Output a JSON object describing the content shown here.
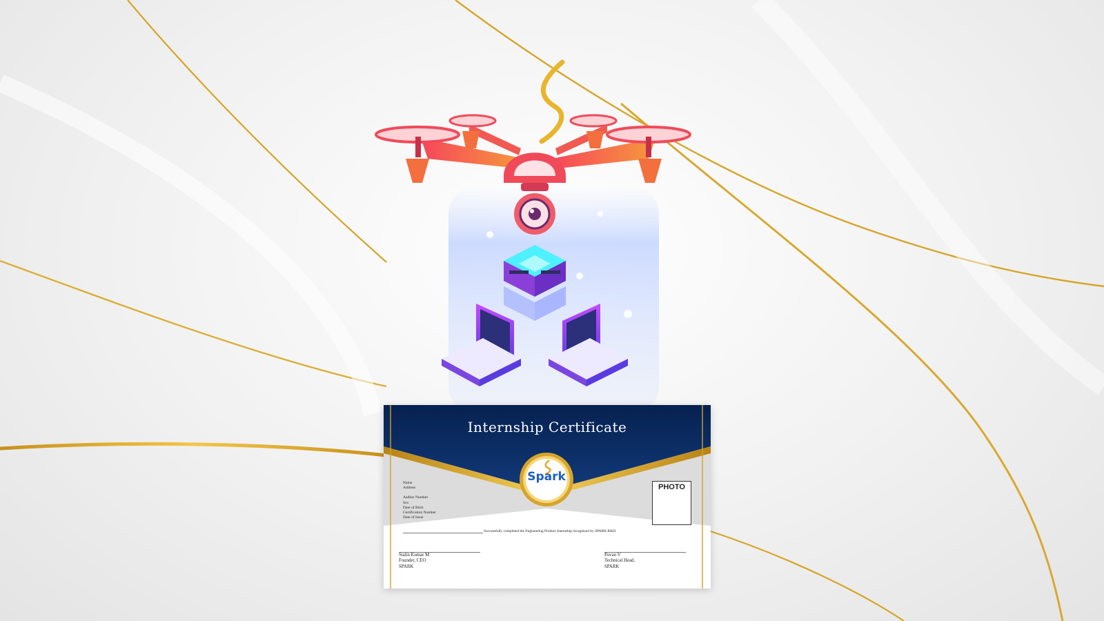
{
  "certificate": {
    "title": "Internship Certificate",
    "logo_text": "Spark",
    "fields": [
      "Name",
      "Address",
      "Aadhar Number",
      "Sex",
      "Date of Birth",
      "Certification Number",
      "Date of Issue"
    ],
    "photo_label": "PHOTO",
    "completion_text": "Successfully completed the Engineering Product Internship recognized by SPARK R&D.",
    "signatories": [
      {
        "name": "Stalin Kumar M",
        "role": "Founder, CEO",
        "org": "SPARK"
      },
      {
        "name": "Puvan V",
        "role": "Technical Head,",
        "org": "SPARK"
      }
    ]
  },
  "colors": {
    "navy": "#0d2a5c",
    "gold": "#d9a520",
    "drone": "#f04a5a",
    "accent": "#8a3bd1"
  },
  "icons": [
    "drone-icon",
    "camera-icon",
    "server-icon",
    "laptop-icon",
    "spark-logo-icon"
  ]
}
